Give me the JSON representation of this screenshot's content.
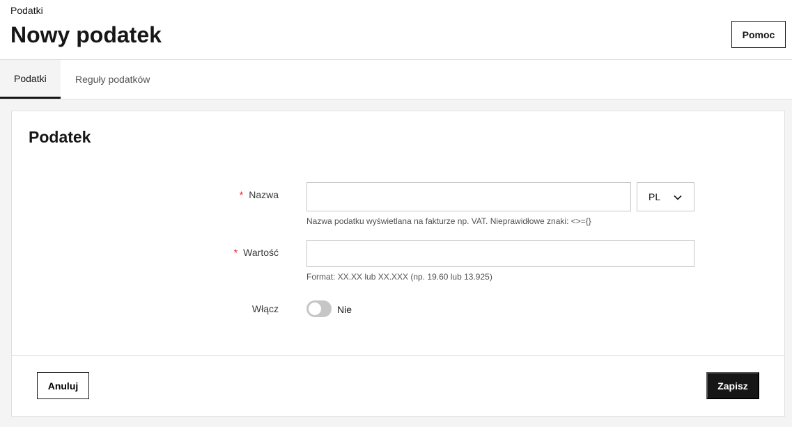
{
  "header": {
    "breadcrumb": "Podatki",
    "title": "Nowy podatek",
    "help_label": "Pomoc"
  },
  "tabs": [
    {
      "label": "Podatki",
      "active": true
    },
    {
      "label": "Reguły podatków",
      "active": false
    }
  ],
  "card": {
    "title": "Podatek",
    "fields": {
      "name": {
        "label": "Nazwa",
        "required": true,
        "value": "",
        "hint": "Nazwa podatku wyświetlana na fakturze np. VAT. Nieprawidłowe znaki: <>={}",
        "language": "PL"
      },
      "value": {
        "label": "Wartość",
        "required": true,
        "value": "",
        "hint": "Format: XX.XX lub XX.XXX (np. 19.60 lub 13.925)"
      },
      "enable": {
        "label": "Włącz",
        "state_text": "Nie",
        "on": false
      }
    },
    "required_mark": "*"
  },
  "footer": {
    "cancel_label": "Anuluj",
    "save_label": "Zapisz"
  },
  "colors": {
    "primary": "#161616",
    "required": "#da1e28",
    "border": "#e0e0e0",
    "background": "#f4f4f4"
  }
}
